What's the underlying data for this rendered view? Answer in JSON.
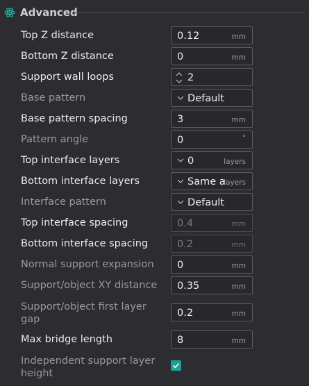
{
  "section": {
    "title": "Advanced",
    "icon": "support-atom-icon"
  },
  "rows": [
    {
      "label": "Top Z distance",
      "value": "0.12",
      "unit": "mm"
    },
    {
      "label": "Bottom Z distance",
      "value": "0",
      "unit": "mm"
    },
    {
      "label": "Support wall loops",
      "value": "2",
      "unit": ""
    },
    {
      "label": "Base pattern",
      "value": "Default",
      "unit": ""
    },
    {
      "label": "Base pattern spacing",
      "value": "3",
      "unit": "mm"
    },
    {
      "label": "Pattern angle",
      "value": "0",
      "unit": "°"
    },
    {
      "label": "Top interface layers",
      "value": "0",
      "unit": "layers"
    },
    {
      "label": "Bottom interface layers",
      "value": "Same as",
      "unit": "layers"
    },
    {
      "label": "Interface pattern",
      "value": "Default",
      "unit": ""
    },
    {
      "label": "Top interface spacing",
      "value": "0.4",
      "unit": "mm"
    },
    {
      "label": "Bottom interface spacing",
      "value": "0.2",
      "unit": "mm"
    },
    {
      "label": "Normal support expansion",
      "value": "0",
      "unit": "mm"
    },
    {
      "label": "Support/object XY distance",
      "value": "0.35",
      "unit": "mm"
    },
    {
      "label_line1": "Support/object first layer",
      "label_line2": "gap",
      "value": "0.2",
      "unit": "mm"
    },
    {
      "label": "Max bridge length",
      "value": "8",
      "unit": "mm"
    },
    {
      "label_line1": "Independent support layer",
      "label_line2": "height",
      "checked": true
    }
  ],
  "colors": {
    "accent": "#1aa393",
    "background": "#2d2d31"
  }
}
